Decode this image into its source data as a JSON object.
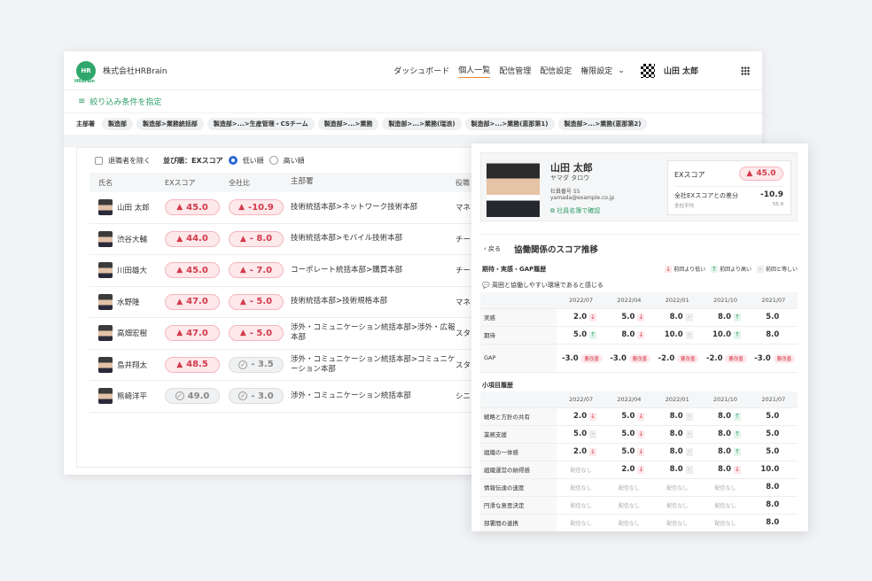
{
  "header": {
    "logo_text": "HR",
    "logo_sub": "HRBrain",
    "company": "株式会社HRBrain",
    "nav": [
      "ダッシュボード",
      "個人一覧",
      "配信管理",
      "配信設定",
      "権限設定"
    ],
    "active_nav": "個人一覧",
    "user": "山田 太郎"
  },
  "filter": {
    "label": "絞り込み条件を指定"
  },
  "dept_filter": {
    "label": "主部署",
    "chips": [
      "製造部",
      "製造部>業務統括部",
      "製造部>...>生産管理・CSチーム",
      "製造部>...>業務",
      "製造部>...>業務(瑞浪)",
      "製造部>...>業務(恵那第1)",
      "製造部>...>業務(恵那第2)"
    ]
  },
  "options": {
    "exclude_retired": "退職者を除く",
    "sort_label": "並び順：EXスコア",
    "sort_low": "低い順",
    "sort_high": "高い順"
  },
  "table": {
    "headers": [
      "氏名",
      "EXスコア",
      "全社比",
      "主部署",
      "役職"
    ],
    "rows": [
      {
        "name": "山田 太郎",
        "ex": "45.0",
        "ex_status": "alert",
        "comp": "-10.9",
        "comp_status": "alert",
        "dept": "技術統括本部>ネットワーク技術本部",
        "role": "マネ"
      },
      {
        "name": "渋谷大輔",
        "ex": "44.0",
        "ex_status": "alert",
        "comp": "- 8.0",
        "comp_status": "alert",
        "dept": "技術統括本部>モバイル技術本部",
        "role": "チー"
      },
      {
        "name": "川田雄大",
        "ex": "45.0",
        "ex_status": "alert",
        "comp": "- 7.0",
        "comp_status": "alert",
        "dept": "コーポレート統括本部>購買本部",
        "role": "チー"
      },
      {
        "name": "水野隆",
        "ex": "47.0",
        "ex_status": "alert",
        "comp": "- 5.0",
        "comp_status": "alert",
        "dept": "技術統括本部>技術規格本部",
        "role": "マネ"
      },
      {
        "name": "高畑宏樹",
        "ex": "47.0",
        "ex_status": "alert",
        "comp": "- 5.0",
        "comp_status": "alert",
        "dept": "渉外・コミュニケーション統括本部>渉外・広報本部",
        "role": "スタ"
      },
      {
        "name": "島井翔太",
        "ex": "48.5",
        "ex_status": "alert",
        "comp": "- 3.5",
        "comp_status": "ok",
        "dept": "渉外・コミュニケーション統括本部>コミュニケーション本部",
        "role": "スタ"
      },
      {
        "name": "熊崎洋平",
        "ex": "49.0",
        "ex_status": "ok",
        "comp": "- 3.0",
        "comp_status": "ok",
        "dept": "渉外・コミュニケーション統括本部",
        "role": "シニ"
      }
    ]
  },
  "detail": {
    "name": "山田 太郎",
    "kana": "ヤマダ タロウ",
    "emp_no": "社員番号 55",
    "email": "yamada@example.co.jp",
    "link": "社員名簿で確認",
    "ex_label": "EXスコア",
    "ex_value": "45.0",
    "diff_label": "全社EXスコアとの差分",
    "diff_value": "-10.9",
    "avg_label": "全社平均",
    "avg_value": "55.9",
    "back": "戻る",
    "title": "協働関係のスコア推移",
    "section1": "期待・実感・GAP履歴",
    "legend": {
      "down": "前回より低い",
      "up": "前回より高い",
      "eq": "前回と等しい"
    },
    "question": "周囲と協働しやすい環境であると感じる",
    "periods": [
      "2022/07",
      "2022/04",
      "2022/01",
      "2021/10",
      "2021/07"
    ],
    "history": [
      {
        "label": "実感",
        "cells": [
          [
            "2.0",
            "down"
          ],
          [
            "5.0",
            "down"
          ],
          [
            "8.0",
            "eq"
          ],
          [
            "8.0",
            "up"
          ],
          [
            "5.0",
            ""
          ]
        ]
      },
      {
        "label": "期待",
        "cells": [
          [
            "5.0",
            "up"
          ],
          [
            "8.0",
            "down"
          ],
          [
            "10.0",
            "eq"
          ],
          [
            "10.0",
            "up"
          ],
          [
            "8.0",
            ""
          ]
        ]
      }
    ],
    "gap": {
      "label": "GAP",
      "values": [
        "-3.0",
        "-3.0",
        "-2.0",
        "-2.0",
        "-3.0"
      ],
      "tag": "要改善"
    },
    "section2": "小項目履歴",
    "no_data": "配信なし",
    "items": [
      {
        "label": "戦略と方針の共有",
        "cells": [
          [
            "2.0",
            "down"
          ],
          [
            "5.0",
            "down"
          ],
          [
            "8.0",
            "eq"
          ],
          [
            "8.0",
            "up"
          ],
          [
            "5.0",
            ""
          ]
        ]
      },
      {
        "label": "業務支援",
        "cells": [
          [
            "5.0",
            "eq"
          ],
          [
            "5.0",
            "down"
          ],
          [
            "8.0",
            "eq"
          ],
          [
            "8.0",
            "up"
          ],
          [
            "5.0",
            ""
          ]
        ]
      },
      {
        "label": "組織の一体感",
        "cells": [
          [
            "2.0",
            "down"
          ],
          [
            "5.0",
            "down"
          ],
          [
            "8.0",
            "eq"
          ],
          [
            "8.0",
            "up"
          ],
          [
            "5.0",
            ""
          ]
        ]
      },
      {
        "label": "組織運営の納得感",
        "cells": [
          [
            "na",
            ""
          ],
          [
            "2.0",
            "down"
          ],
          [
            "8.0",
            "eq"
          ],
          [
            "8.0",
            "down"
          ],
          [
            "10.0",
            ""
          ]
        ]
      },
      {
        "label": "情報伝達の速度",
        "cells": [
          [
            "na",
            ""
          ],
          [
            "na",
            ""
          ],
          [
            "na",
            ""
          ],
          [
            "na",
            ""
          ],
          [
            "8.0",
            ""
          ]
        ]
      },
      {
        "label": "円滑な意思決定",
        "cells": [
          [
            "na",
            ""
          ],
          [
            "na",
            ""
          ],
          [
            "na",
            ""
          ],
          [
            "na",
            ""
          ],
          [
            "8.0",
            ""
          ]
        ]
      },
      {
        "label": "部署間の連携",
        "cells": [
          [
            "na",
            ""
          ],
          [
            "na",
            ""
          ],
          [
            "na",
            ""
          ],
          [
            "na",
            ""
          ],
          [
            "8.0",
            ""
          ]
        ]
      }
    ]
  }
}
